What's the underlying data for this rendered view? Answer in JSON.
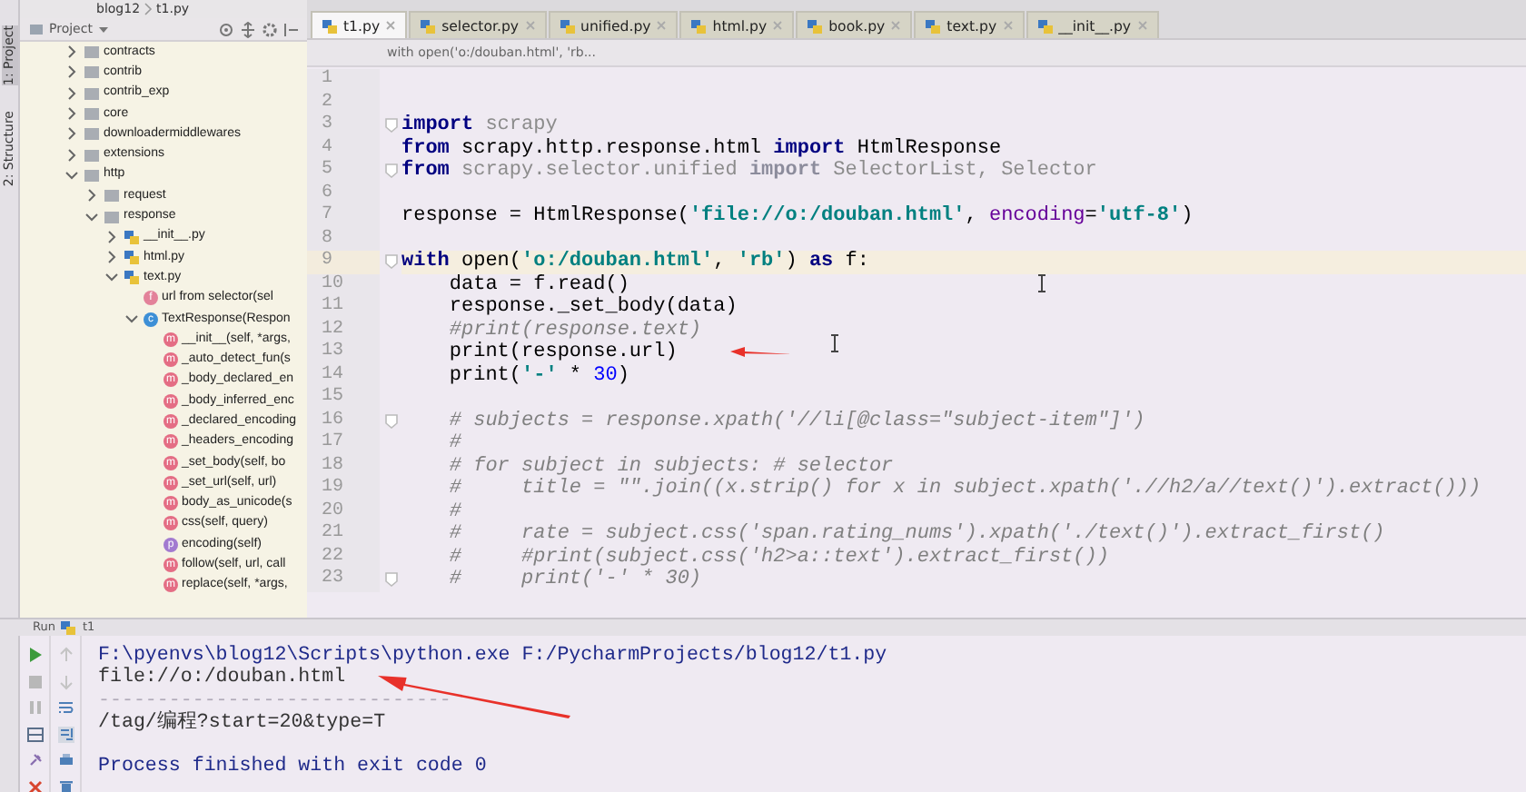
{
  "nav": {
    "items": [
      "blog12",
      "t1.py"
    ]
  },
  "side_strip": {
    "tabs": [
      "1: Project",
      "2: Structure"
    ]
  },
  "project": {
    "title": "Project",
    "tree": [
      {
        "label": "contracts",
        "kind": "folder",
        "expanded": false
      },
      {
        "label": "contrib",
        "kind": "folder",
        "expanded": false
      },
      {
        "label": "contrib_exp",
        "kind": "folder",
        "expanded": false
      },
      {
        "label": "core",
        "kind": "folder",
        "expanded": false
      },
      {
        "label": "downloadermiddlewares",
        "kind": "folder",
        "expanded": false
      },
      {
        "label": "extensions",
        "kind": "folder",
        "expanded": false
      },
      {
        "label": "http",
        "kind": "folder",
        "expanded": true,
        "children": [
          {
            "label": "request",
            "kind": "folder",
            "expanded": false
          },
          {
            "label": "response",
            "kind": "folder",
            "expanded": true,
            "children": [
              {
                "label": "__init__.py",
                "kind": "python",
                "expanded": false
              },
              {
                "label": "html.py",
                "kind": "python",
                "expanded": false
              },
              {
                "label": "text.py",
                "kind": "python",
                "expanded": true,
                "children": [
                  {
                    "label": "url from selector(sel",
                    "kind": "function",
                    "badge": "f"
                  },
                  {
                    "label": "TextResponse(Respon",
                    "kind": "class",
                    "badge": "c",
                    "expanded": true,
                    "children": [
                      {
                        "label": "__init__(self, *args,",
                        "kind": "method",
                        "badge": "m"
                      },
                      {
                        "label": "_auto_detect_fun(s",
                        "kind": "method",
                        "badge": "m"
                      },
                      {
                        "label": "_body_declared_en",
                        "kind": "method",
                        "badge": "m"
                      },
                      {
                        "label": "_body_inferred_enc",
                        "kind": "method",
                        "badge": "m"
                      },
                      {
                        "label": "_declared_encoding",
                        "kind": "method",
                        "badge": "m"
                      },
                      {
                        "label": "_headers_encoding",
                        "kind": "method",
                        "badge": "m"
                      },
                      {
                        "label": "_set_body(self, bo",
                        "kind": "method",
                        "badge": "m"
                      },
                      {
                        "label": "_set_url(self, url)",
                        "kind": "method",
                        "badge": "m"
                      },
                      {
                        "label": "body_as_unicode(s",
                        "kind": "method",
                        "badge": "m"
                      },
                      {
                        "label": "css(self, query)",
                        "kind": "method",
                        "badge": "m"
                      },
                      {
                        "label": "encoding(self)",
                        "kind": "property",
                        "badge": "p"
                      },
                      {
                        "label": "follow(self, url, call",
                        "kind": "method",
                        "badge": "m"
                      },
                      {
                        "label": "replace(self, *args,",
                        "kind": "method",
                        "badge": "m"
                      }
                    ]
                  }
                ]
              }
            ]
          }
        ]
      }
    ]
  },
  "editor": {
    "tabs": [
      {
        "label": "t1.py",
        "selected": true
      },
      {
        "label": "selector.py",
        "selected": false
      },
      {
        "label": "unified.py",
        "selected": false
      },
      {
        "label": "html.py",
        "selected": false
      },
      {
        "label": "book.py",
        "selected": false
      },
      {
        "label": "text.py",
        "selected": false
      },
      {
        "label": "__init__.py",
        "selected": false
      }
    ],
    "breadcrumb": "with open('o:/douban.html', 'rb...",
    "lines": [
      {
        "number": "1",
        "highlighted": false
      },
      {
        "number": "2",
        "highlighted": false
      },
      {
        "number": "3",
        "highlighted": false,
        "fold_marker": true,
        "tokens": [
          {
            "kind": "keyword",
            "text": "import"
          },
          {
            "kind": "unused",
            "text": " scrapy"
          }
        ]
      },
      {
        "number": "4",
        "highlighted": false,
        "tokens": [
          {
            "kind": "keyword",
            "text": "from"
          },
          {
            "kind": "plain",
            "text": " scrapy.http.response.html "
          },
          {
            "kind": "keyword",
            "text": "import"
          },
          {
            "kind": "plain",
            "text": " HtmlResponse"
          }
        ]
      },
      {
        "number": "5",
        "highlighted": false,
        "fold_marker": true,
        "tokens": [
          {
            "kind": "keyword",
            "text": "from"
          },
          {
            "kind": "unused",
            "text": " scrapy.selector.unified "
          },
          {
            "kind": "unused_keyword",
            "text": "import"
          },
          {
            "kind": "unused",
            "text": " SelectorList, Selector"
          }
        ]
      },
      {
        "number": "6",
        "highlighted": false
      },
      {
        "number": "7",
        "highlighted": false,
        "tokens": [
          {
            "kind": "plain",
            "text": "response = HtmlResponse("
          },
          {
            "kind": "string",
            "text": "'file://o:/douban.html'"
          },
          {
            "kind": "plain",
            "text": ", "
          },
          {
            "kind": "param",
            "text": "encoding"
          },
          {
            "kind": "plain",
            "text": "="
          },
          {
            "kind": "string",
            "text": "'utf-8'"
          },
          {
            "kind": "plain",
            "text": ")"
          }
        ]
      },
      {
        "number": "8",
        "highlighted": false
      },
      {
        "number": "9",
        "highlighted": true,
        "fold_marker": true,
        "tokens": [
          {
            "kind": "keyword",
            "text": "with"
          },
          {
            "kind": "plain",
            "text": " open("
          },
          {
            "kind": "string",
            "text": "'o:/douban.html'"
          },
          {
            "kind": "plain",
            "text": ", "
          },
          {
            "kind": "string",
            "text": "'rb'"
          },
          {
            "kind": "plain",
            "text": ") "
          },
          {
            "kind": "keyword",
            "text": "as"
          },
          {
            "kind": "plain",
            "text": " f:"
          }
        ]
      },
      {
        "number": "10",
        "highlighted": false,
        "tokens": [
          {
            "kind": "plain",
            "text": "    data = f.read()"
          }
        ]
      },
      {
        "number": "11",
        "highlighted": false,
        "tokens": [
          {
            "kind": "plain",
            "text": "    response._set_body(data)"
          }
        ]
      },
      {
        "number": "12",
        "highlighted": false,
        "tokens": [
          {
            "kind": "comment",
            "text": "    #print(response.text)"
          }
        ]
      },
      {
        "number": "13",
        "highlighted": false,
        "annotated": true,
        "tokens": [
          {
            "kind": "plain",
            "text": "    print(response.url)"
          }
        ]
      },
      {
        "number": "14",
        "highlighted": false,
        "tokens": [
          {
            "kind": "plain",
            "text": "    print("
          },
          {
            "kind": "string",
            "text": "'-'"
          },
          {
            "kind": "plain",
            "text": " * "
          },
          {
            "kind": "number",
            "text": "30"
          },
          {
            "kind": "plain",
            "text": ")"
          }
        ]
      },
      {
        "number": "15",
        "highlighted": false
      },
      {
        "number": "16",
        "highlighted": false,
        "fold_marker": true,
        "tokens": [
          {
            "kind": "comment",
            "text": "    # subjects = response.xpath('//li[@class=\"subject-item\"]')"
          }
        ]
      },
      {
        "number": "17",
        "highlighted": false,
        "tokens": [
          {
            "kind": "comment",
            "text": "    #"
          }
        ]
      },
      {
        "number": "18",
        "highlighted": false,
        "tokens": [
          {
            "kind": "comment",
            "text": "    # for subject in subjects: # selector"
          }
        ]
      },
      {
        "number": "19",
        "highlighted": false,
        "tokens": [
          {
            "kind": "comment",
            "text": "    #     title = \"\".join((x.strip() for x in subject.xpath('.//h2/a//text()').extract()))"
          }
        ]
      },
      {
        "number": "20",
        "highlighted": false,
        "tokens": [
          {
            "kind": "comment",
            "text": "    #"
          }
        ]
      },
      {
        "number": "21",
        "highlighted": false,
        "tokens": [
          {
            "kind": "comment",
            "text": "    #     rate = subject.css('span.rating_nums').xpath('./text()').extract_first()"
          }
        ]
      },
      {
        "number": "22",
        "highlighted": false,
        "tokens": [
          {
            "kind": "comment",
            "text": "    #     #print(subject.css('h2>a::text').extract_first())"
          }
        ]
      },
      {
        "number": "23",
        "highlighted": false,
        "fold_marker": true,
        "tokens": [
          {
            "kind": "comment",
            "text": "    #     print('-' * 30)"
          }
        ]
      }
    ]
  },
  "run": {
    "title": "Run",
    "config": "t1",
    "output": [
      {
        "kind": "command",
        "text": "F:\\pyenvs\\blog12\\Scripts\\python.exe F:/PycharmProjects/blog12/t1.py",
        "annotated": false
      },
      {
        "kind": "stdout",
        "text": "file://o:/douban.html",
        "annotated": true
      },
      {
        "kind": "separator",
        "text": "------------------------------",
        "annotated": false
      },
      {
        "kind": "stdout",
        "text": "/tag/编程?start=20&type=T",
        "annotated": false
      },
      {
        "kind": "status",
        "text": "Process finished with exit code 0",
        "annotated": false
      }
    ]
  }
}
